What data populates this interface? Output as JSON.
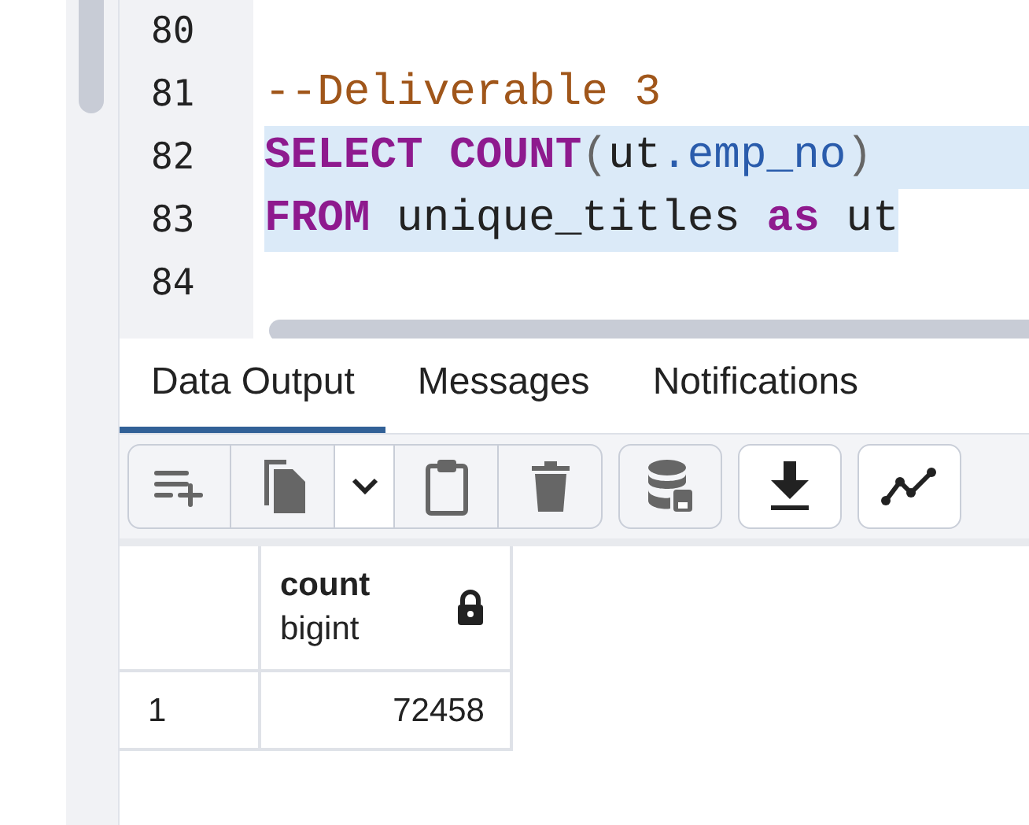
{
  "editor": {
    "lines": [
      {
        "number": "80",
        "selected": false
      },
      {
        "number": "81",
        "selected": false,
        "tokens": [
          {
            "kind": "comment",
            "text": "--Deliverable 3"
          }
        ]
      },
      {
        "number": "82",
        "selected": true,
        "tokens": [
          {
            "kind": "keyword",
            "text": "SELECT"
          },
          {
            "kind": "keyword",
            "text": " COUNT"
          },
          {
            "kind": "punct",
            "text": "("
          },
          {
            "kind": "plain",
            "text": "ut"
          },
          {
            "kind": "property",
            "text": ".emp_no"
          },
          {
            "kind": "punct",
            "text": ")"
          }
        ]
      },
      {
        "number": "83",
        "selected": true,
        "tokens": [
          {
            "kind": "keyword",
            "text": "FROM"
          },
          {
            "kind": "plain",
            "text": " unique_titles "
          },
          {
            "kind": "keyword",
            "text": "as"
          },
          {
            "kind": "plain",
            "text": " ut"
          }
        ]
      },
      {
        "number": "84",
        "selected": false
      }
    ]
  },
  "tabs": [
    {
      "label": "Data Output",
      "selected": true
    },
    {
      "label": "Messages",
      "selected": false
    },
    {
      "label": "Notifications",
      "selected": false
    }
  ],
  "toolbar": [
    {
      "kind": "add-row"
    },
    {
      "kind": "copy"
    },
    {
      "kind": "dropdown"
    },
    {
      "kind": "paste"
    },
    {
      "kind": "delete"
    },
    {
      "kind": "save-data"
    },
    {
      "kind": "download"
    },
    {
      "kind": "graph"
    }
  ],
  "table": {
    "columns": [
      {
        "name": "count",
        "type": "bigint",
        "locked": true
      }
    ],
    "rows": [
      {
        "number": "1",
        "cells": [
          "72458"
        ]
      }
    ]
  }
}
